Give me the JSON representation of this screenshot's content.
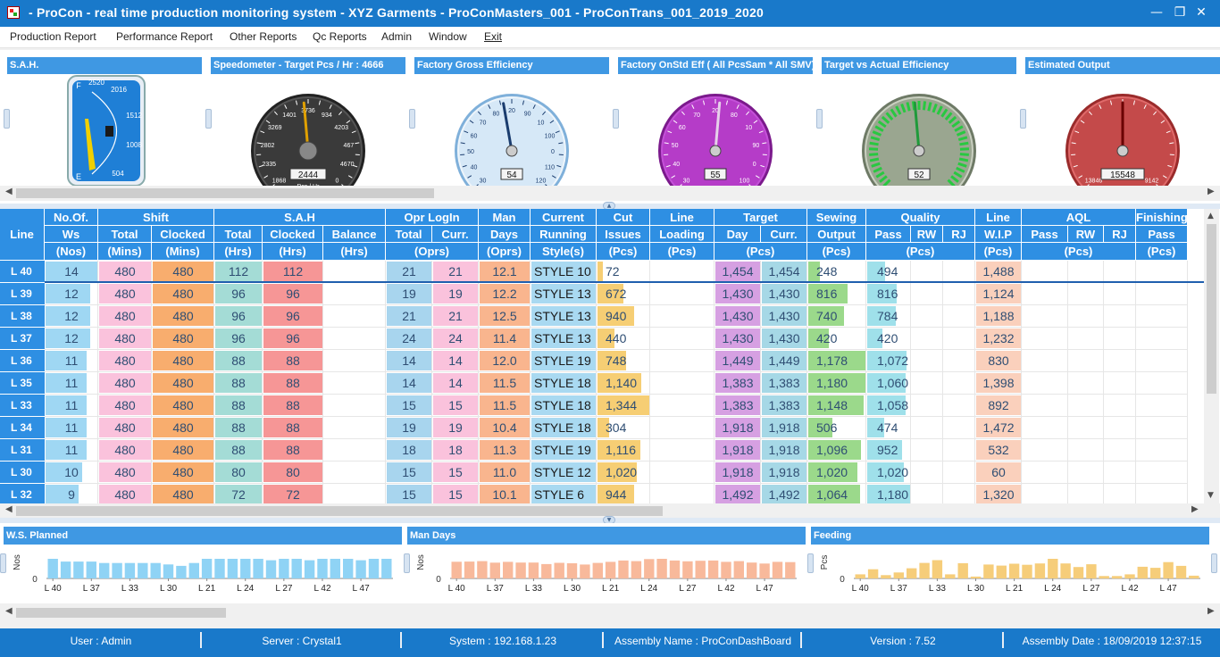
{
  "window": {
    "title": "- ProCon  -  real time production monitoring system  -  XYZ Garments  -  ProConMasters_001  -  ProConTrans_001_2019_2020",
    "minimize_glyph": "—",
    "restore_glyph": "❐",
    "close_glyph": "✕"
  },
  "menu": [
    "Production Report",
    "Performance Report",
    "Other Reports",
    "Qc Reports",
    "Admin",
    "Window",
    "Exit"
  ],
  "gauges": [
    {
      "title": "S.A.H.",
      "kind": "fuel",
      "labels": [
        "2520",
        "2016",
        "1512",
        "1008",
        "504",
        "F",
        "E"
      ],
      "colors": {
        "face": "#1f7fd6",
        "needle": "#f0d000"
      }
    },
    {
      "title": "Speedometer - Target Pcs / Hr : 4666",
      "kind": "speed",
      "labels": [
        "1868",
        "2335",
        "2802",
        "3269",
        "1401",
        "3736",
        "934",
        "4203",
        "467",
        "4670",
        "0"
      ],
      "readout": "2444",
      "unit": "Pcs / Hr",
      "colors": {
        "face": "#3a3a3a",
        "needle": "#e0a000"
      }
    },
    {
      "title": "Factory Gross Efficiency",
      "kind": "eff",
      "labels": [
        "30",
        "40",
        "50",
        "60",
        "70",
        "80",
        "20",
        "90",
        "10",
        "100",
        "0",
        "110",
        "120"
      ],
      "readout": "54",
      "colors": {
        "face": "#d6e8f7",
        "needle": "#1a3c6e"
      }
    },
    {
      "title": "Factory OnStd Eff ( All PcsSam * All SMV)",
      "kind": "purple",
      "labels": [
        "30",
        "40",
        "50",
        "60",
        "70",
        "20",
        "80",
        "10",
        "90",
        "0",
        "100"
      ],
      "readout": "55",
      "colors": {
        "face": "#b53cc8",
        "needle": "#e6d0ea"
      }
    },
    {
      "title": "Target vs Actual Efficiency",
      "kind": "green",
      "labels": [],
      "readout": "52",
      "colors": {
        "face": "#9aa690",
        "needle": "#1f9a3a"
      }
    },
    {
      "title": "Estimated Output",
      "kind": "red",
      "labels": [
        "13846",
        "9142"
      ],
      "readout": "15548",
      "colors": {
        "face": "#c44a4a",
        "needle": "#6a0000"
      }
    }
  ],
  "grid": {
    "groups": [
      {
        "label": "No.Of.",
        "col": 1,
        "span": 1
      },
      {
        "label": "Shift",
        "col": 2,
        "span": 2
      },
      {
        "label": "S.A.H",
        "col": 4,
        "span": 3
      },
      {
        "label": "Opr LogIn",
        "col": 7,
        "span": 2
      },
      {
        "label": "Man",
        "col": 9,
        "span": 1
      },
      {
        "label": "Current",
        "col": 10,
        "span": 1
      },
      {
        "label": "Cut",
        "col": 11,
        "span": 1
      },
      {
        "label": "Line",
        "col": 12,
        "span": 1
      },
      {
        "label": "Target",
        "col": 13,
        "span": 2
      },
      {
        "label": "Sewing",
        "col": 15,
        "span": 1
      },
      {
        "label": "Quality",
        "col": 16,
        "span": 3
      },
      {
        "label": "Line",
        "col": 19,
        "span": 1
      },
      {
        "label": "AQL",
        "col": 20,
        "span": 3
      },
      {
        "label": "Finishing",
        "col": 23,
        "span": 1
      }
    ],
    "subheads": [
      "Line",
      "Ws",
      "Total",
      "Clocked",
      "Total",
      "Clocked",
      "Balance",
      "Total",
      "Curr.",
      "Days",
      "Running",
      "Issues",
      "Loading",
      "Day",
      "Curr.",
      "Output",
      "Pass",
      "RW",
      "RJ",
      "W.I.P",
      "Pass",
      "RW",
      "RJ",
      "Pass"
    ],
    "units": [
      {
        "label": "(Nos)",
        "col": 1,
        "span": 1
      },
      {
        "label": "(Mins)",
        "col": 2,
        "span": 1
      },
      {
        "label": "(Mins)",
        "col": 3,
        "span": 1
      },
      {
        "label": "(Hrs)",
        "col": 4,
        "span": 1
      },
      {
        "label": "(Hrs)",
        "col": 5,
        "span": 1
      },
      {
        "label": "(Hrs)",
        "col": 6,
        "span": 1
      },
      {
        "label": "(Oprs)",
        "col": 7,
        "span": 2
      },
      {
        "label": "(Oprs)",
        "col": 9,
        "span": 1
      },
      {
        "label": "Style(s)",
        "col": 10,
        "span": 1
      },
      {
        "label": "(Pcs)",
        "col": 11,
        "span": 1
      },
      {
        "label": "(Pcs)",
        "col": 12,
        "span": 1
      },
      {
        "label": "(Pcs)",
        "col": 13,
        "span": 2
      },
      {
        "label": "(Pcs)",
        "col": 15,
        "span": 1
      },
      {
        "label": "(Pcs)",
        "col": 16,
        "span": 3
      },
      {
        "label": "(Pcs)",
        "col": 19,
        "span": 1
      },
      {
        "label": "(Pcs)",
        "col": 20,
        "span": 3
      },
      {
        "label": "(Pcs)",
        "col": 23,
        "span": 1
      }
    ],
    "col_colors": [
      "#ffffff",
      "#9fd7f3",
      "#fac2dc",
      "#f8ad6e",
      "#a4dcd6",
      "#f69696",
      "#ffffff",
      "#a8d5ee",
      "#fac2dc",
      "#f9b58e",
      "#a9d9f1",
      "#f6ce74",
      "#ffffff",
      "#d6a0e2",
      "#a6d8e6",
      "#9bd98b",
      "#9fe0ea",
      "#ffffff",
      "#ffffff",
      "#fad0bc",
      "#ffffff",
      "#ffffff",
      "#ffffff",
      "#ffffff"
    ],
    "fill_cols": {
      "1": 14,
      "11": 1344,
      "15": 1180,
      "16": 1180
    },
    "rows": [
      {
        "line": "L 40",
        "ws": "14",
        "shift_total": "480",
        "shift_clocked": "480",
        "sah_total": "112",
        "sah_clocked": "112",
        "balance": "",
        "opr_total": "21",
        "opr_curr": "21",
        "man_days": "12.1",
        "style": "STYLE 10",
        "cut": "72",
        "loading": "",
        "target_day": "1,454",
        "target_curr": "1,454",
        "sewing": "248",
        "q_pass": "494",
        "q_rw": "",
        "q_rj": "",
        "wip": "1,488"
      },
      {
        "line": "L 39",
        "ws": "12",
        "shift_total": "480",
        "shift_clocked": "480",
        "sah_total": "96",
        "sah_clocked": "96",
        "balance": "",
        "opr_total": "19",
        "opr_curr": "19",
        "man_days": "12.2",
        "style": "STYLE 13",
        "cut": "672",
        "loading": "",
        "target_day": "1,430",
        "target_curr": "1,430",
        "sewing": "816",
        "q_pass": "816",
        "q_rw": "",
        "q_rj": "",
        "wip": "1,124"
      },
      {
        "line": "L 38",
        "ws": "12",
        "shift_total": "480",
        "shift_clocked": "480",
        "sah_total": "96",
        "sah_clocked": "96",
        "balance": "",
        "opr_total": "21",
        "opr_curr": "21",
        "man_days": "12.5",
        "style": "STYLE 13",
        "cut": "940",
        "loading": "",
        "target_day": "1,430",
        "target_curr": "1,430",
        "sewing": "740",
        "q_pass": "784",
        "q_rw": "",
        "q_rj": "",
        "wip": "1,188"
      },
      {
        "line": "L 37",
        "ws": "12",
        "shift_total": "480",
        "shift_clocked": "480",
        "sah_total": "96",
        "sah_clocked": "96",
        "balance": "",
        "opr_total": "24",
        "opr_curr": "24",
        "man_days": "11.4",
        "style": "STYLE 13",
        "cut": "440",
        "loading": "",
        "target_day": "1,430",
        "target_curr": "1,430",
        "sewing": "420",
        "q_pass": "420",
        "q_rw": "",
        "q_rj": "",
        "wip": "1,232"
      },
      {
        "line": "L 36",
        "ws": "11",
        "shift_total": "480",
        "shift_clocked": "480",
        "sah_total": "88",
        "sah_clocked": "88",
        "balance": "",
        "opr_total": "14",
        "opr_curr": "14",
        "man_days": "12.0",
        "style": "STYLE 19",
        "cut": "748",
        "loading": "",
        "target_day": "1,449",
        "target_curr": "1,449",
        "sewing": "1,178",
        "q_pass": "1,072",
        "q_rw": "",
        "q_rj": "",
        "wip": "830"
      },
      {
        "line": "L 35",
        "ws": "11",
        "shift_total": "480",
        "shift_clocked": "480",
        "sah_total": "88",
        "sah_clocked": "88",
        "balance": "",
        "opr_total": "14",
        "opr_curr": "14",
        "man_days": "11.5",
        "style": "STYLE 18",
        "cut": "1,140",
        "loading": "",
        "target_day": "1,383",
        "target_curr": "1,383",
        "sewing": "1,180",
        "q_pass": "1,060",
        "q_rw": "",
        "q_rj": "",
        "wip": "1,398"
      },
      {
        "line": "L 33",
        "ws": "11",
        "shift_total": "480",
        "shift_clocked": "480",
        "sah_total": "88",
        "sah_clocked": "88",
        "balance": "",
        "opr_total": "15",
        "opr_curr": "15",
        "man_days": "11.5",
        "style": "STYLE 18",
        "cut": "1,344",
        "loading": "",
        "target_day": "1,383",
        "target_curr": "1,383",
        "sewing": "1,148",
        "q_pass": "1,058",
        "q_rw": "",
        "q_rj": "",
        "wip": "892"
      },
      {
        "line": "L 34",
        "ws": "11",
        "shift_total": "480",
        "shift_clocked": "480",
        "sah_total": "88",
        "sah_clocked": "88",
        "balance": "",
        "opr_total": "19",
        "opr_curr": "19",
        "man_days": "10.4",
        "style": "STYLE 18",
        "cut": "304",
        "loading": "",
        "target_day": "1,918",
        "target_curr": "1,918",
        "sewing": "506",
        "q_pass": "474",
        "q_rw": "",
        "q_rj": "",
        "wip": "1,472"
      },
      {
        "line": "L 31",
        "ws": "11",
        "shift_total": "480",
        "shift_clocked": "480",
        "sah_total": "88",
        "sah_clocked": "88",
        "balance": "",
        "opr_total": "18",
        "opr_curr": "18",
        "man_days": "11.3",
        "style": "STYLE 19",
        "cut": "1,116",
        "loading": "",
        "target_day": "1,918",
        "target_curr": "1,918",
        "sewing": "1,096",
        "q_pass": "952",
        "q_rw": "",
        "q_rj": "",
        "wip": "532"
      },
      {
        "line": "L 30",
        "ws": "10",
        "shift_total": "480",
        "shift_clocked": "480",
        "sah_total": "80",
        "sah_clocked": "80",
        "balance": "",
        "opr_total": "15",
        "opr_curr": "15",
        "man_days": "11.0",
        "style": "STYLE 12",
        "cut": "1,020",
        "loading": "",
        "target_day": "1,918",
        "target_curr": "1,918",
        "sewing": "1,020",
        "q_pass": "1,020",
        "q_rw": "",
        "q_rj": "",
        "wip": "60"
      },
      {
        "line": "L 32",
        "ws": "9",
        "shift_total": "480",
        "shift_clocked": "480",
        "sah_total": "72",
        "sah_clocked": "72",
        "balance": "",
        "opr_total": "15",
        "opr_curr": "15",
        "man_days": "10.1",
        "style": "STYLE 6",
        "cut": "944",
        "loading": "",
        "target_day": "1,492",
        "target_curr": "1,492",
        "sewing": "1,064",
        "q_pass": "1,180",
        "q_rw": "",
        "q_rj": "",
        "wip": "1,320"
      }
    ]
  },
  "charts": [
    {
      "title": "W.S. Planned",
      "ylabel": "Nos",
      "ytick": "0",
      "xticks": [
        "L 40",
        "L 37",
        "L 33",
        "L 30",
        "L 21",
        "L 24",
        "L 27",
        "L 42",
        "L 47"
      ],
      "color": "#8fd3f5",
      "values": [
        14,
        12,
        12,
        12,
        11,
        11,
        11,
        11,
        11,
        10,
        9,
        11,
        14,
        14,
        14,
        14,
        14,
        13,
        14,
        14,
        13,
        14,
        14,
        14,
        13,
        14,
        14
      ]
    },
    {
      "title": "Man Days",
      "ylabel": "Nos",
      "ytick": "0",
      "xticks": [
        "L 40",
        "L 37",
        "L 33",
        "L 30",
        "L 21",
        "L 24",
        "L 27",
        "L 42",
        "L 47"
      ],
      "color": "#f8b99b",
      "values": [
        12.1,
        12.2,
        12.5,
        11.4,
        12.0,
        11.5,
        11.5,
        10.4,
        11.3,
        11.0,
        10.1,
        11.2,
        12.0,
        13.0,
        12.5,
        14.0,
        14.2,
        13.0,
        12.4,
        12.8,
        13.0,
        12.0,
        12.5,
        11.5,
        10.8,
        12.0,
        11.8
      ]
    },
    {
      "title": "Feeding",
      "ylabel": "Pcs",
      "ytick": "0",
      "xticks": [
        "L 40",
        "L 37",
        "L 33",
        "L 30",
        "L 21",
        "L 24",
        "L 27",
        "L 42",
        "L 47"
      ],
      "color": "#f6cd7a",
      "values": [
        300,
        672,
        240,
        440,
        748,
        1140,
        1344,
        304,
        1116,
        140,
        1020,
        944,
        1080,
        1000,
        1100,
        1440,
        1100,
        840,
        1040,
        180,
        180,
        300,
        860,
        780,
        1200,
        920,
        200
      ]
    }
  ],
  "status": {
    "user": "User : Admin",
    "server": "Server : Crystal1",
    "system": "System : 192.168.1.23",
    "assembly": "Assembly Name : ProConDashBoard",
    "version": "Version : 7.52",
    "assembly_date": "Assembly Date : 18/09/2019 12:37:15"
  }
}
